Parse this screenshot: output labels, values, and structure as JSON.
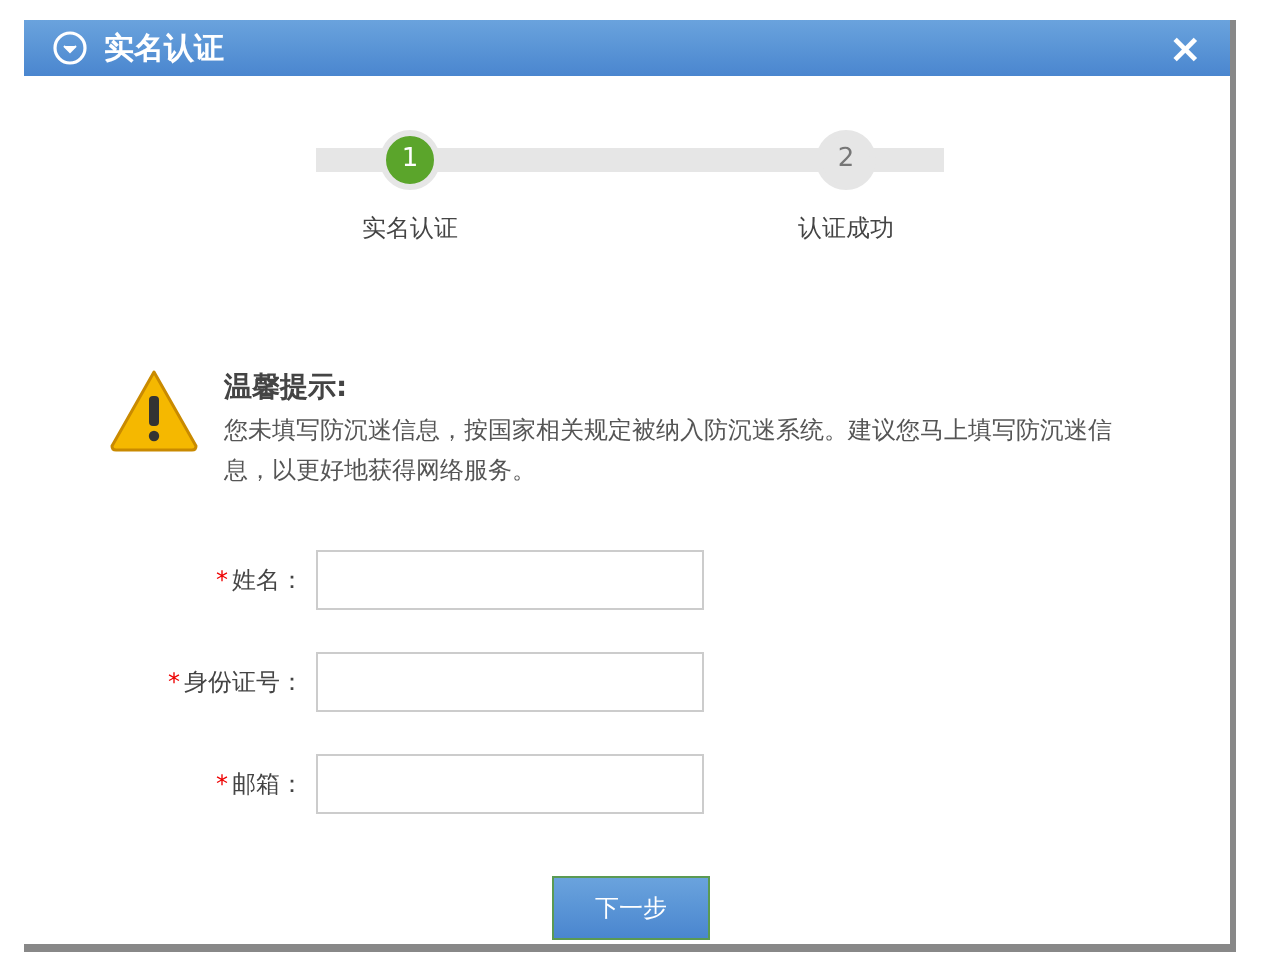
{
  "dialog": {
    "title": "实名认证",
    "close": "×"
  },
  "steps": [
    {
      "number": "1",
      "label": "实名认证",
      "selected": true
    },
    {
      "number": "2",
      "label": "认证成功",
      "selected": false
    }
  ],
  "notice": {
    "title": "温馨提示:",
    "text": "您未填写防沉迷信息，按国家相关规定被纳入防沉迷系统。建议您马上填写防沉迷信息，以更好地获得网络服务。"
  },
  "fields": [
    {
      "label": "姓名：",
      "required": true,
      "mark": "*"
    },
    {
      "label": "身份证号：",
      "required": true,
      "mark": "*"
    },
    {
      "label": "邮箱：",
      "required": true,
      "mark": "*"
    }
  ],
  "submit": "下一步"
}
